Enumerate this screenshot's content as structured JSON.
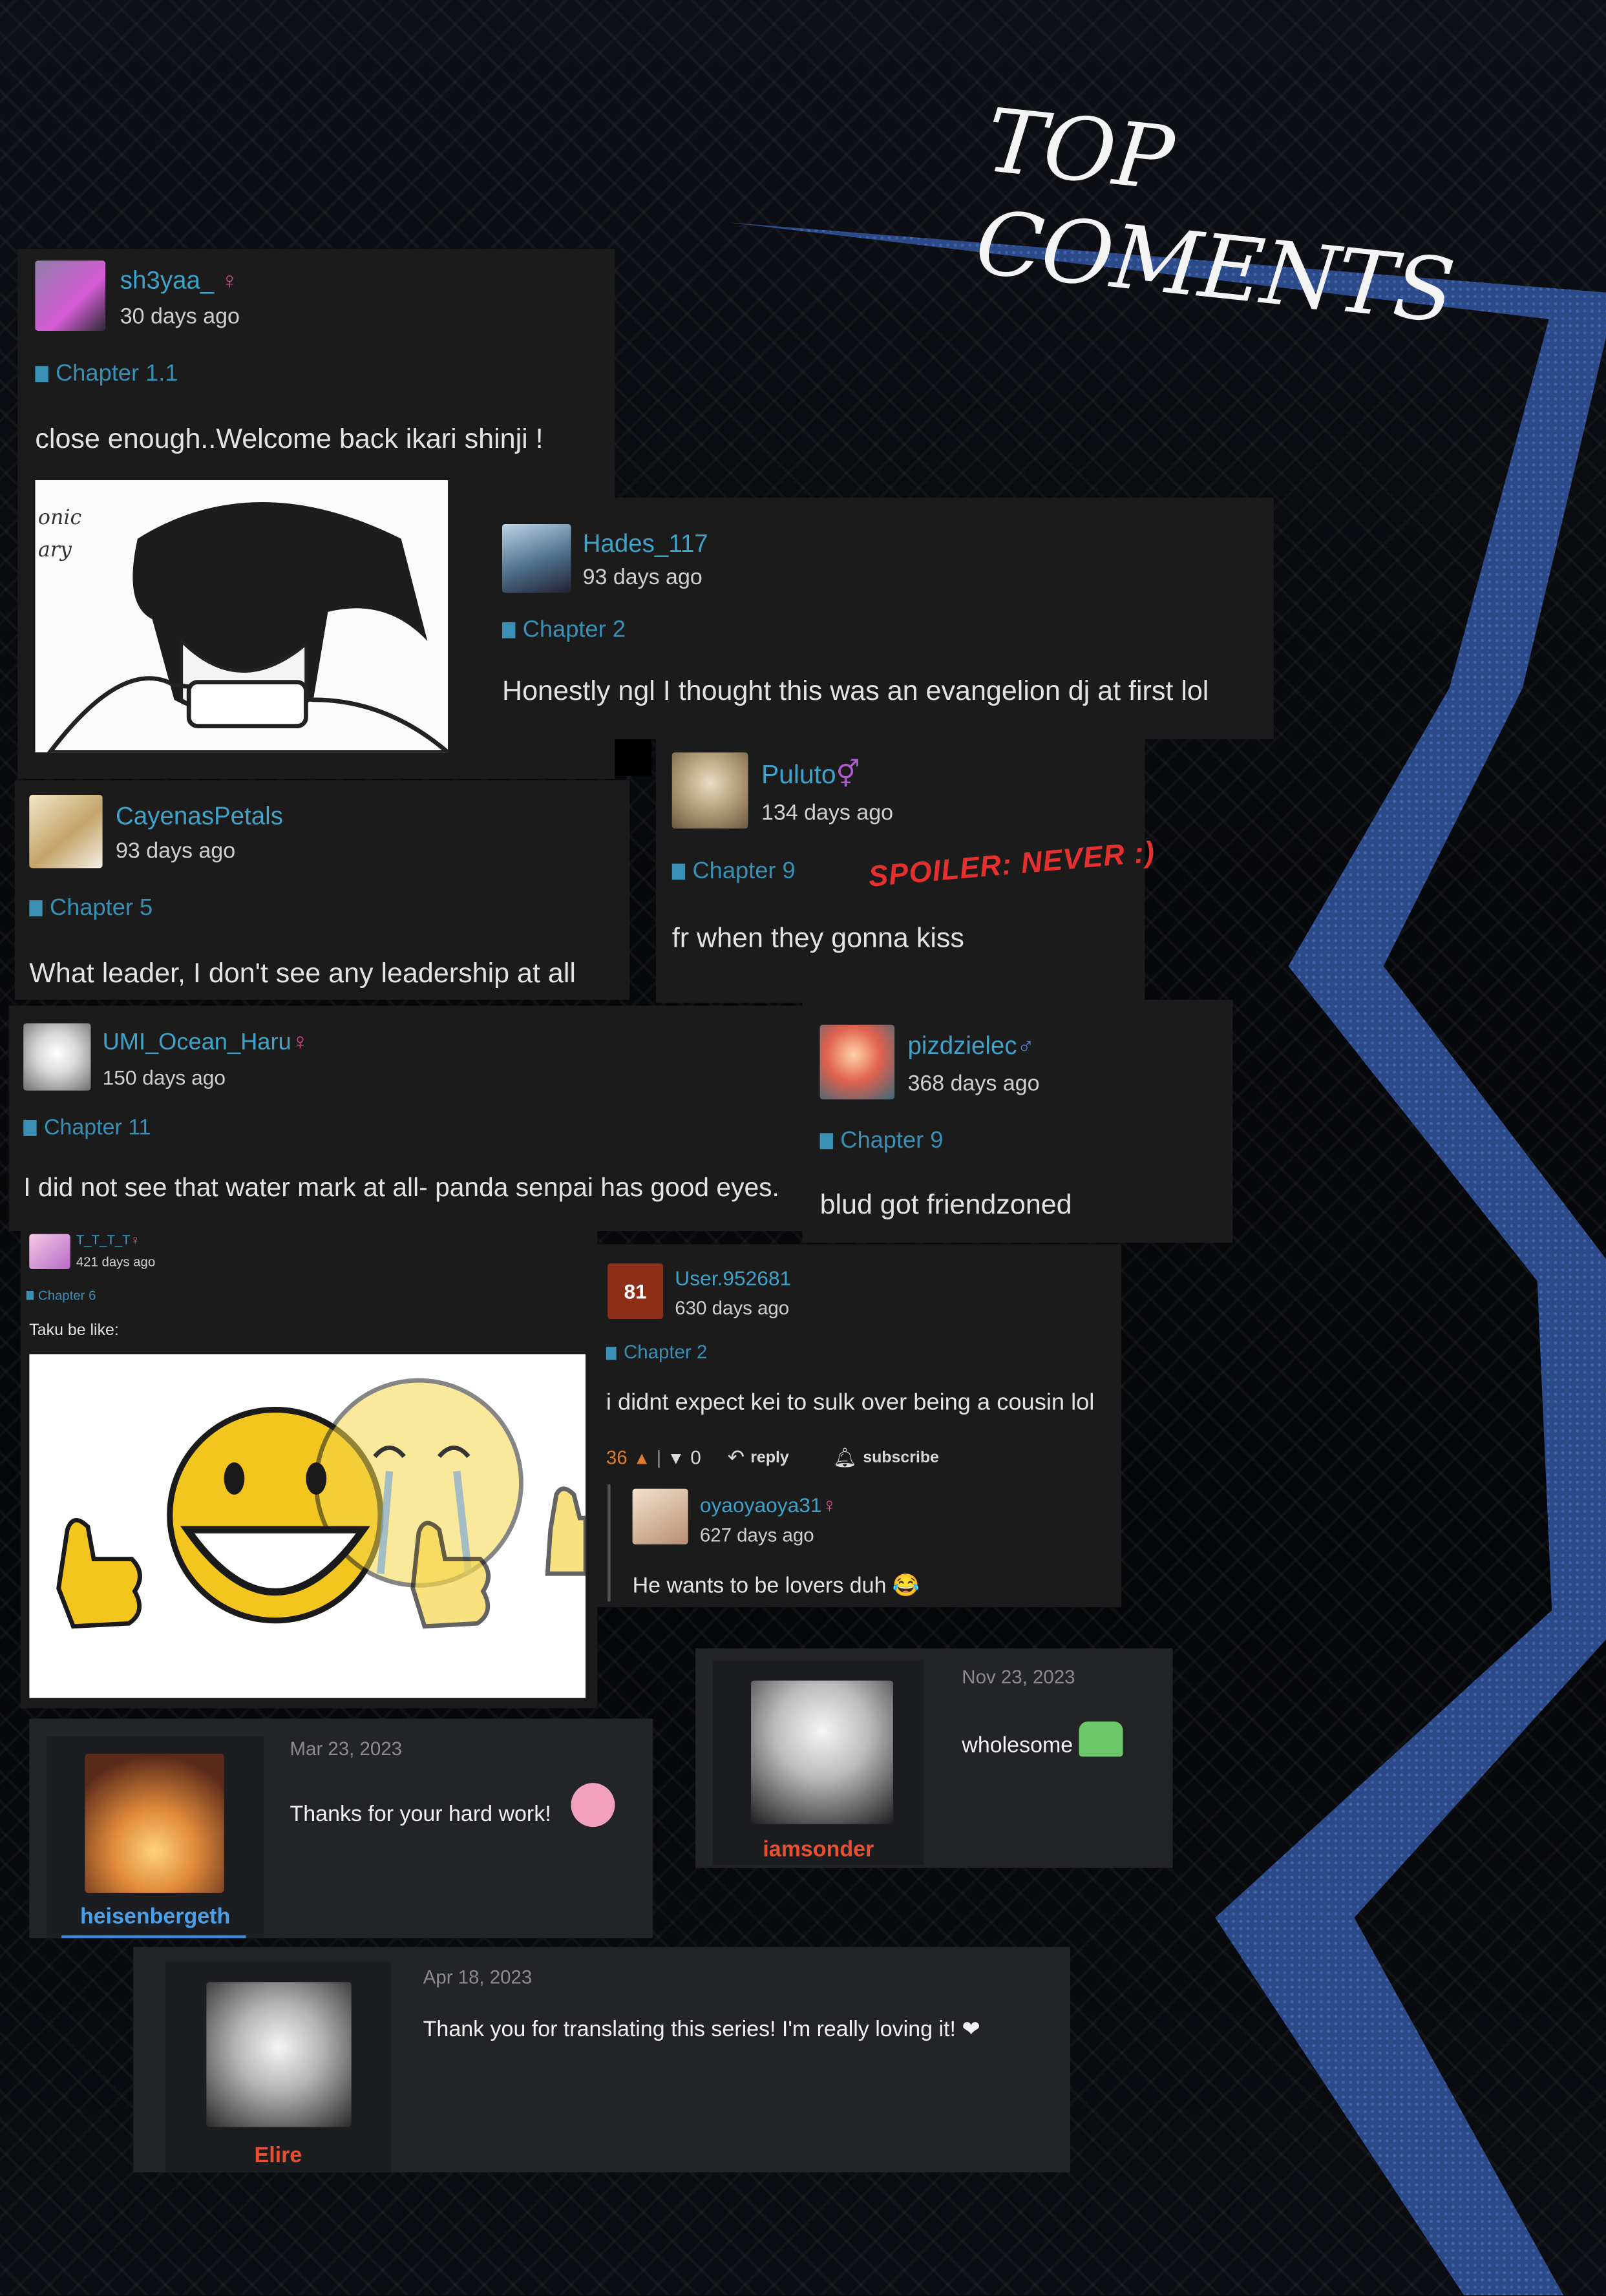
{
  "page": {
    "title": "TOP COMENTS"
  },
  "spoiler_note": "SPOILER: NEVER :)",
  "comments": [
    {
      "user": "sh3yaa_",
      "gender": "♀",
      "ago": "30 days ago",
      "chapter": "Chapter 1.1",
      "text": "close enough..Welcome back ikari shinji !",
      "image_text": "onic\nary"
    },
    {
      "user": "Hades_117",
      "ago": "93 days ago",
      "chapter": "Chapter 2",
      "text": "Honestly ngl I thought this was an evangelion dj at first lol"
    },
    {
      "user": "CayenasPetals",
      "ago": "93 days ago",
      "chapter": "Chapter 5",
      "text": "What leader, I don't see any leadership at all"
    },
    {
      "user": "Puluto",
      "gender": "⚥",
      "ago": "134 days ago",
      "chapter": "Chapter 9",
      "text": "fr when they gonna kiss"
    },
    {
      "user": "UMI_Ocean_Haru",
      "gender": "♀",
      "ago": "150 days ago",
      "chapter": "Chapter 11",
      "text": "I did not see that water mark at all- panda senpai has good eyes."
    },
    {
      "user": "pizdzielec",
      "gender": "♂",
      "ago": "368 days ago",
      "chapter": "Chapter 9",
      "text": "blud got friendzoned"
    },
    {
      "user": "T_T_T_T",
      "gender": "♀",
      "ago": "421 days ago",
      "chapter": "Chapter 6",
      "text": "Taku be like:"
    },
    {
      "user": "User.952681",
      "avatar_text": "81",
      "ago": "630 days ago",
      "chapter": "Chapter 2",
      "text": "i didnt expect kei to sulk over being a cousin lol",
      "votes_up": "36",
      "votes_down": "0",
      "reply_label": "reply",
      "subscribe_label": "subscribe",
      "reply": {
        "user": "oyaoyaoya31",
        "gender": "♀",
        "ago": "627 days ago",
        "text": "He wants to be lovers duh 😂"
      }
    }
  ],
  "forum_posts": [
    {
      "user": "iamsonder",
      "date": "Nov 23, 2023",
      "text": "wholesome",
      "name_color": "#e8502f"
    },
    {
      "user": "heisenbergeth",
      "date": "Mar 23, 2023",
      "text": "Thanks for your hard work!",
      "name_color": "#4a9fe8"
    },
    {
      "user": "Elire",
      "date": "Apr 18, 2023",
      "text": "Thank you for translating this series! I'm really loving it! ❤",
      "name_color": "#e8502f"
    }
  ],
  "colors": {
    "accent_blue": "#3fa2c9",
    "ribbon": "#2f4d8f",
    "spoiler_red": "#e53030"
  }
}
